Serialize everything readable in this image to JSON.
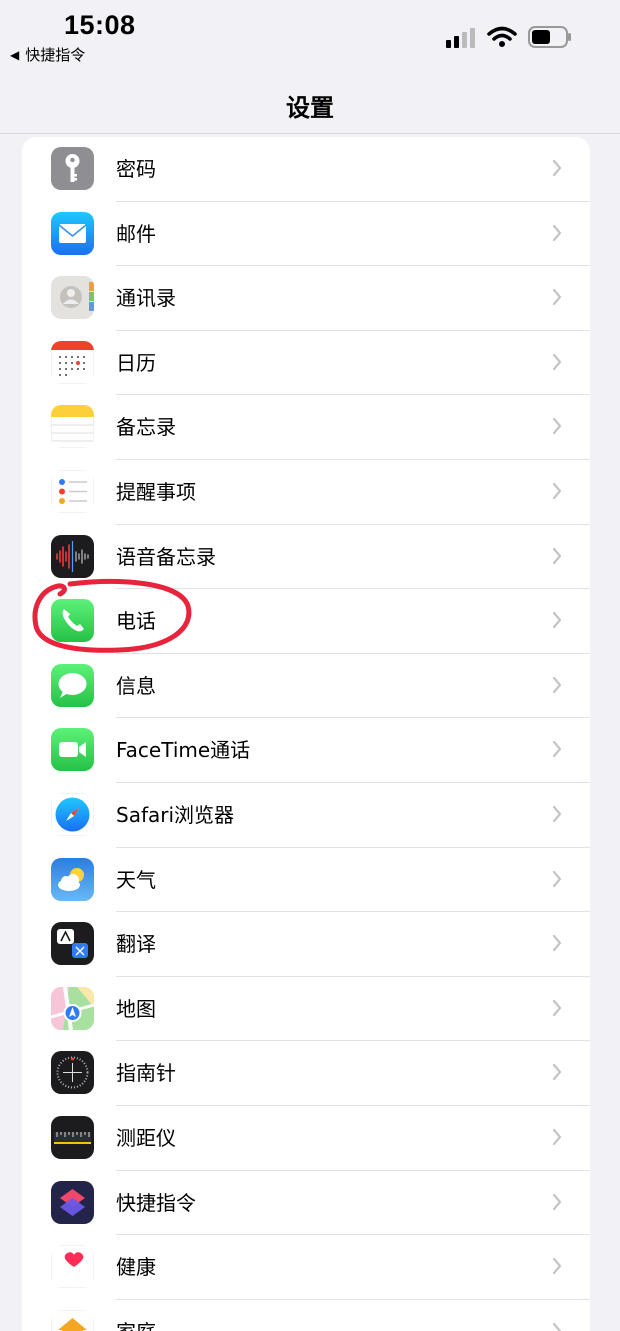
{
  "status_bar": {
    "time": "15:08",
    "back_label": "快捷指令"
  },
  "nav": {
    "title": "设置"
  },
  "settings": {
    "items": [
      {
        "label": "密码",
        "icon": "key-icon"
      },
      {
        "label": "邮件",
        "icon": "mail-icon"
      },
      {
        "label": "通讯录",
        "icon": "contacts-icon"
      },
      {
        "label": "日历",
        "icon": "calendar-icon"
      },
      {
        "label": "备忘录",
        "icon": "notes-icon"
      },
      {
        "label": "提醒事项",
        "icon": "reminders-icon"
      },
      {
        "label": "语音备忘录",
        "icon": "voice-memos-icon"
      },
      {
        "label": "电话",
        "icon": "phone-icon"
      },
      {
        "label": "信息",
        "icon": "messages-icon"
      },
      {
        "label": "FaceTime通话",
        "icon": "facetime-icon"
      },
      {
        "label": "Safari浏览器",
        "icon": "safari-icon"
      },
      {
        "label": "天气",
        "icon": "weather-icon"
      },
      {
        "label": "翻译",
        "icon": "translate-icon"
      },
      {
        "label": "地图",
        "icon": "maps-icon"
      },
      {
        "label": "指南针",
        "icon": "compass-icon"
      },
      {
        "label": "测距仪",
        "icon": "measure-icon"
      },
      {
        "label": "快捷指令",
        "icon": "shortcuts-icon"
      },
      {
        "label": "健康",
        "icon": "health-icon"
      },
      {
        "label": "家庭",
        "icon": "home-icon"
      }
    ]
  },
  "colors": {
    "background": "#f1f1f6",
    "annotation": "#e8243c",
    "chevron": "#c4c4c7"
  }
}
